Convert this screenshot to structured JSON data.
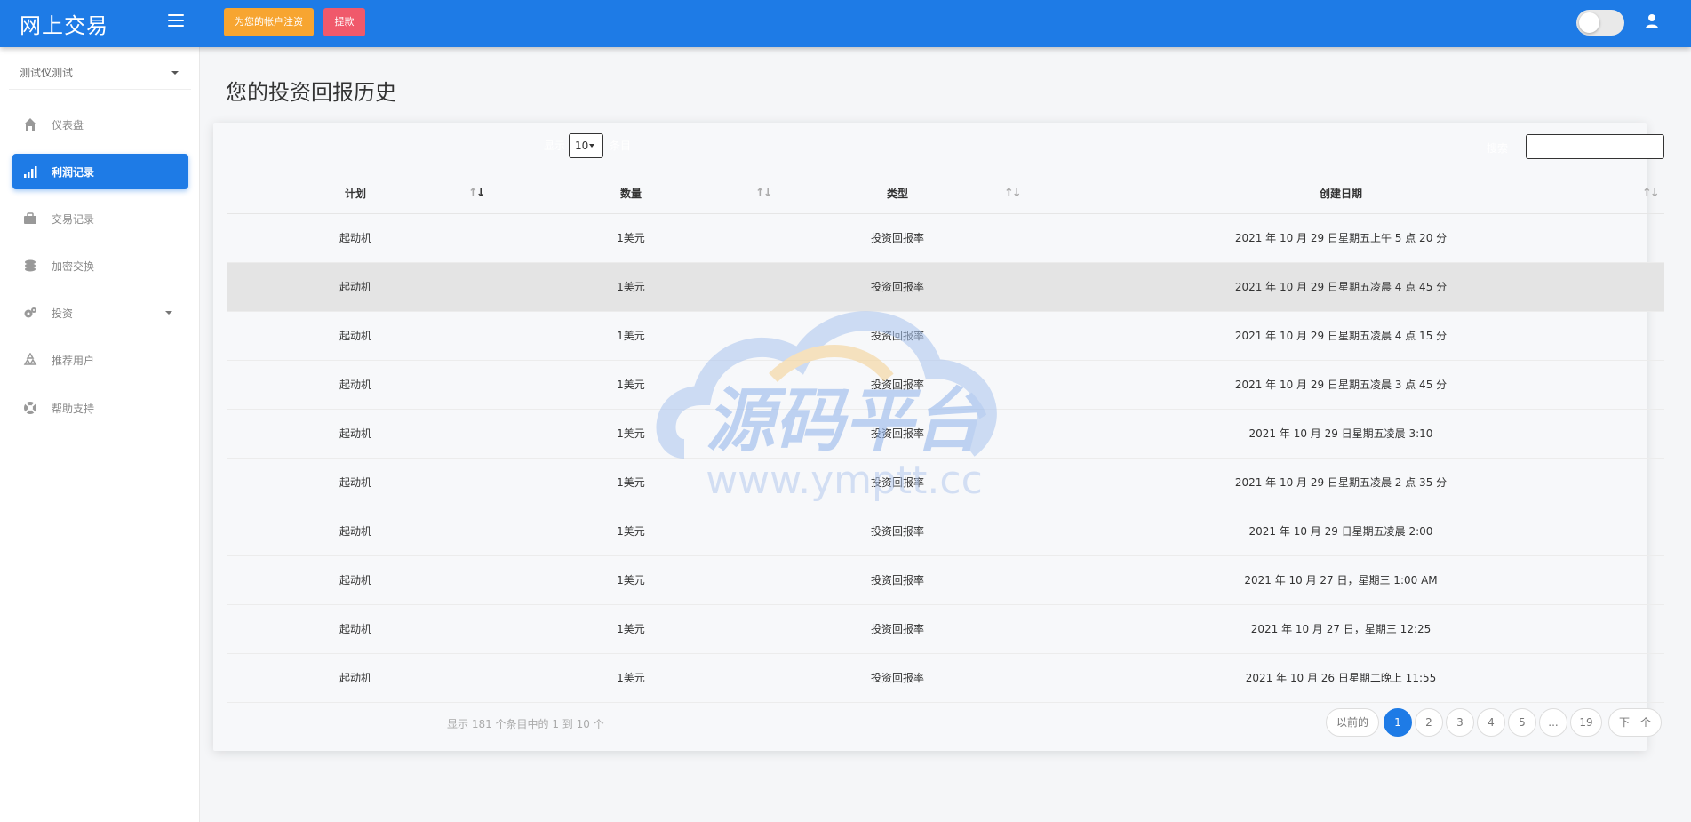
{
  "header": {
    "brand": "网上交易",
    "deposit_label": "为您的帐户注资",
    "withdraw_label": "提款"
  },
  "sidebar": {
    "account_name": "测试仪测试",
    "items": [
      {
        "label": "仪表盘",
        "icon": "home-icon"
      },
      {
        "label": "利润记录",
        "icon": "signal-bars-icon"
      },
      {
        "label": "交易记录",
        "icon": "briefcase-icon"
      },
      {
        "label": "加密交换",
        "icon": "coins-icon"
      },
      {
        "label": "投资",
        "icon": "cogs-icon"
      },
      {
        "label": "推荐用户",
        "icon": "recycle-icon"
      },
      {
        "label": "帮助支持",
        "icon": "lifebuoy-icon"
      }
    ]
  },
  "main": {
    "title": "您的投资回报历史",
    "length_label_before": "显示",
    "length_value": "10",
    "length_label_after": "条目",
    "search_label": "搜索",
    "columns": [
      "计划",
      "数量",
      "类型",
      "创建日期"
    ],
    "rows": [
      [
        "起动机",
        "1美元",
        "投资回报率",
        "2021 年 10 月 29 日星期五上午 5 点 20 分"
      ],
      [
        "起动机",
        "1美元",
        "投资回报率",
        "2021 年 10 月 29 日星期五凌晨 4 点 45 分"
      ],
      [
        "起动机",
        "1美元",
        "投资回报率",
        "2021 年 10 月 29 日星期五凌晨 4 点 15 分"
      ],
      [
        "起动机",
        "1美元",
        "投资回报率",
        "2021 年 10 月 29 日星期五凌晨 3 点 45 分"
      ],
      [
        "起动机",
        "1美元",
        "投资回报率",
        "2021 年 10 月 29 日星期五凌晨 3:10"
      ],
      [
        "起动机",
        "1美元",
        "投资回报率",
        "2021 年 10 月 29 日星期五凌晨 2 点 35 分"
      ],
      [
        "起动机",
        "1美元",
        "投资回报率",
        "2021 年 10 月 29 日星期五凌晨 2:00"
      ],
      [
        "起动机",
        "1美元",
        "投资回报率",
        "2021 年 10 月 27 日，星期三 1:00 AM"
      ],
      [
        "起动机",
        "1美元",
        "投资回报率",
        "2021 年 10 月 27 日，星期三 12:25"
      ],
      [
        "起动机",
        "1美元",
        "投资回报率",
        "2021 年 10 月 26 日星期二晚上 11:55"
      ]
    ],
    "info": "显示 181 个条目中的 1 到 10 个",
    "pagination": {
      "prev": "以前的",
      "pages": [
        "1",
        "2",
        "3",
        "4",
        "5",
        "...",
        "19"
      ],
      "next": "下一个",
      "active": "1"
    }
  },
  "watermark": {
    "title": "源码平台",
    "url": "www.ymptt.cc"
  },
  "colors": {
    "primary": "#1e7be6",
    "deposit": "#f7a531",
    "withdraw": "#f0596b"
  }
}
